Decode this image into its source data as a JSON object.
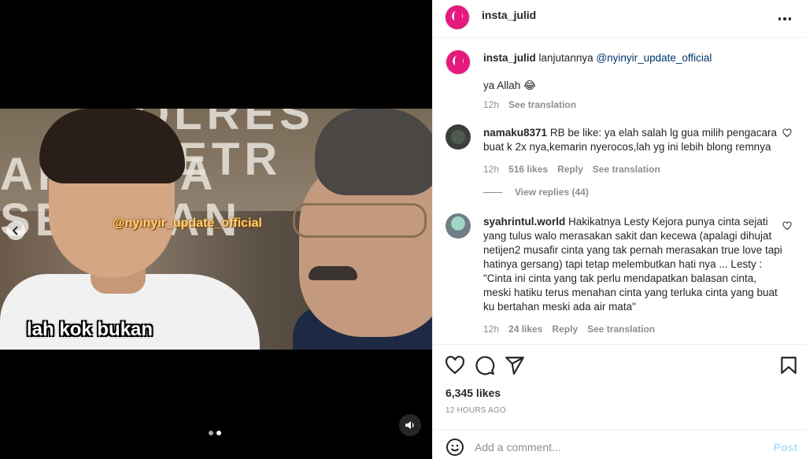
{
  "media": {
    "banner_line1": "OLRES METR",
    "banner_line2": "AKARTA SELATAN",
    "watermark": "@nyinyir_update_official",
    "caption": "lah kok bukan",
    "prev_icon": "chevron-left-icon",
    "mute_icon": "volume-icon",
    "carousel_total": 2,
    "carousel_active": 2
  },
  "header": {
    "username": "insta_julid",
    "more_icon": "more-horizontal-icon"
  },
  "post_caption": {
    "username": "insta_julid",
    "text": "lanjutannya",
    "mention": "@nyinyir_update_official",
    "second_line": "ya Allah",
    "emoji": "😂",
    "time": "12h",
    "see_translation": "See translation"
  },
  "comments": [
    {
      "username": "namaku8371",
      "text": "RB be like: ya elah salah lg gua milih pengacara buat k 2x nya,kemarin nyerocos,lah yg ini lebih blong remnya",
      "time": "12h",
      "likes": "516 likes",
      "reply": "Reply",
      "see_translation": "See translation"
    },
    {
      "username": "syahrintul.world",
      "text": "Hakikatnya Lesty Kejora punya cinta sejati yang tulus walo merasakan sakit dan kecewa (apalagi dihujat netijen2 musafir cinta yang tak pernah merasakan true love tapi hatinya gersang) tapi tetap melembutkan hati nya ... Lesty : \"Cinta ini cinta yang tak perlu mendapatkan balasan cinta, meski hatiku terus menahan cinta yang terluka cinta yang buat ku bertahan meski ada air mata\"",
      "time": "12h",
      "likes": "24 likes",
      "reply": "Reply",
      "see_translation": "See translation"
    }
  ],
  "view_replies": "View replies (44)",
  "actions": {
    "like_icon": "heart-icon",
    "comment_icon": "comment-icon",
    "share_icon": "send-icon",
    "save_icon": "bookmark-icon",
    "likes_count": "6,345 likes",
    "time_ago": "12 HOURS AGO"
  },
  "add_comment": {
    "emoji_icon": "emoji-icon",
    "placeholder": "Add a comment...",
    "post_label": "Post"
  },
  "colors": {
    "post_button_disabled": "#b2dffc",
    "secondary_text": "#8e8e8e",
    "primary_text": "#262626",
    "avatar_brand": "#e6197e"
  }
}
